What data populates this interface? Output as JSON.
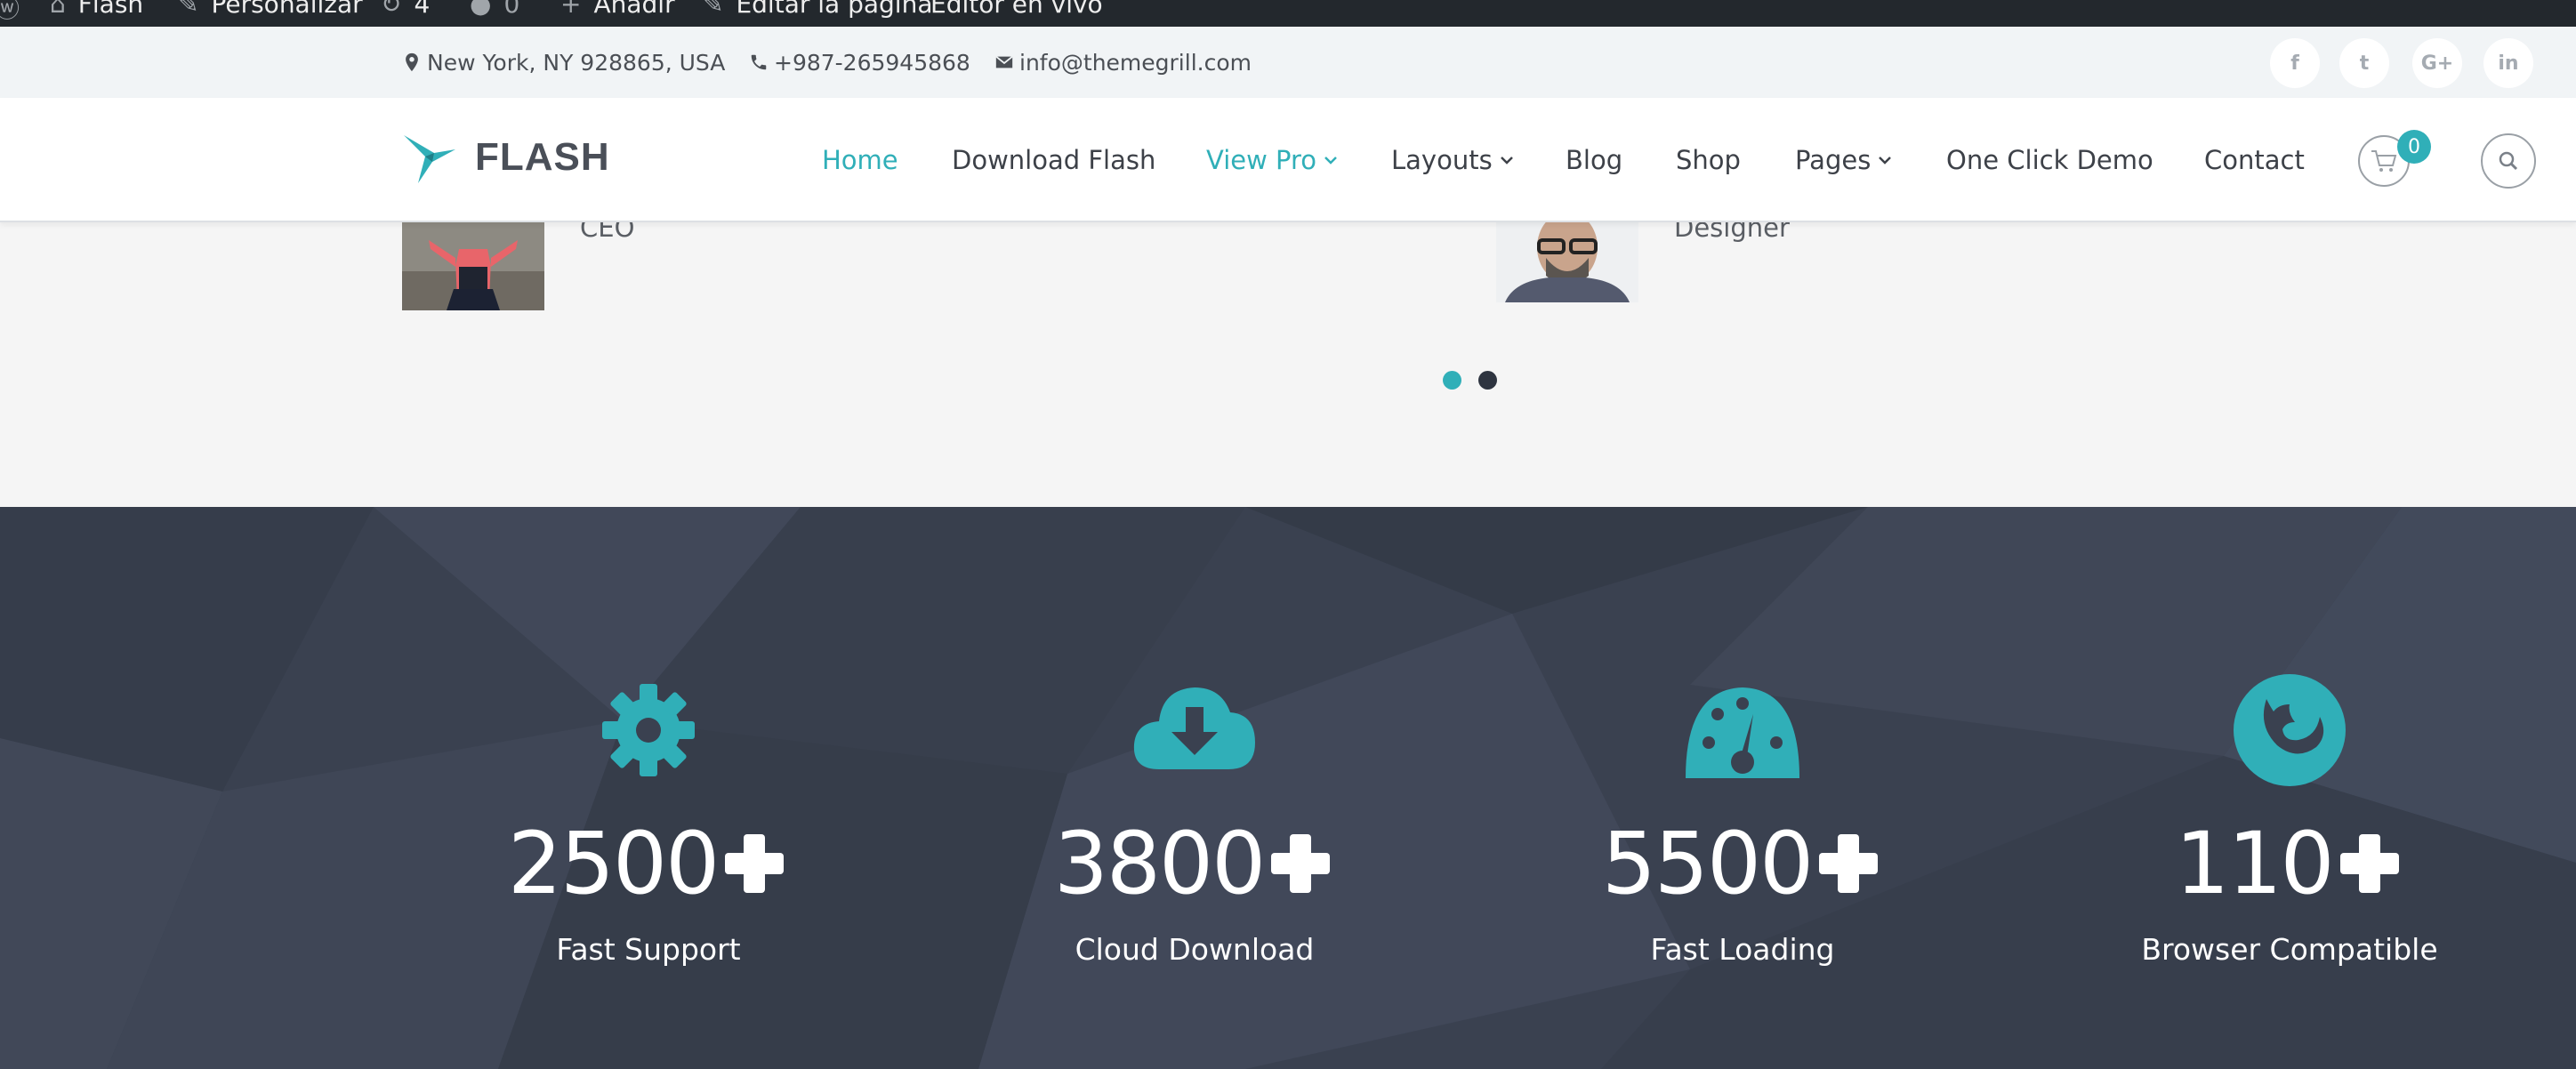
{
  "adminbar": {
    "items": [
      "Flash",
      "Personalizar",
      "4",
      "0",
      "Añadir",
      "Editar la página",
      "Editor en vivo"
    ]
  },
  "infobar": {
    "address": "New York, NY 928865, USA",
    "phone": "+987-265945868",
    "email": "info@themegrill.com",
    "social": [
      "f",
      "t",
      "G+",
      "in"
    ]
  },
  "header": {
    "logo": "FLASH",
    "nav": [
      {
        "label": "Home",
        "active": true,
        "dropdown": false
      },
      {
        "label": "Download Flash",
        "active": false,
        "dropdown": false
      },
      {
        "label": "View Pro",
        "active": true,
        "dropdown": true
      },
      {
        "label": "Layouts",
        "active": false,
        "dropdown": true
      },
      {
        "label": "Blog",
        "active": false,
        "dropdown": false
      },
      {
        "label": "Shop",
        "active": false,
        "dropdown": false
      },
      {
        "label": "Pages",
        "active": false,
        "dropdown": true
      },
      {
        "label": "One Click Demo",
        "active": false,
        "dropdown": false
      },
      {
        "label": "Contact",
        "active": false,
        "dropdown": false
      }
    ],
    "cart_count": "0"
  },
  "team": {
    "members": [
      {
        "role": "CEO"
      },
      {
        "role": "Designer"
      }
    ],
    "active_slide": 1,
    "slide_count": 2
  },
  "counters": [
    {
      "value": "2500",
      "label": "Fast Support",
      "icon": "gear-icon"
    },
    {
      "value": "3800",
      "label": "Cloud Download",
      "icon": "cloud-download-icon"
    },
    {
      "value": "5500",
      "label": "Fast Loading",
      "icon": "dashboard-icon"
    },
    {
      "value": "110",
      "label": "Browser Compatible",
      "icon": "firefox-icon"
    }
  ],
  "colors": {
    "accent": "#30afb8",
    "dark_bg": "#3a4150",
    "adminbar": "#23282d",
    "infobar": "#f1f4f6"
  }
}
